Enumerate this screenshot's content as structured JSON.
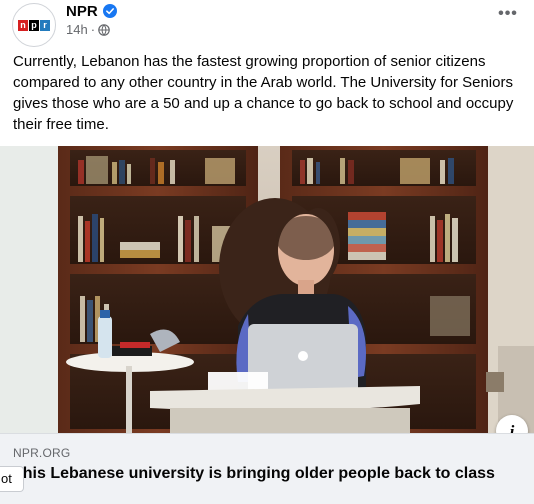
{
  "post": {
    "page_name": "NPR",
    "timestamp": "14h",
    "separator": "·",
    "verified": true,
    "audience_icon": "globe-icon",
    "more_label": "•••",
    "text": "Currently, Lebanon has the fastest growing proportion of senior citizens compared to any other country in the Arab world.  The University for Seniors gives those who are a 50 and up a chance to go back to school and occupy their free time."
  },
  "avatar": {
    "logo_letters": [
      "n",
      "p",
      "r"
    ]
  },
  "link_preview": {
    "domain": "NPR.ORG",
    "title": "This Lebanese university is bringing older people back to class",
    "info_label": "i"
  },
  "overlay": {
    "chip_label": "ot"
  },
  "colors": {
    "text_primary": "#050505",
    "text_secondary": "#65676b",
    "verified_blue": "#1877f2",
    "preview_bg": "#f0f2f5",
    "npr_red": "#d62021",
    "npr_blue": "#237bbd"
  }
}
